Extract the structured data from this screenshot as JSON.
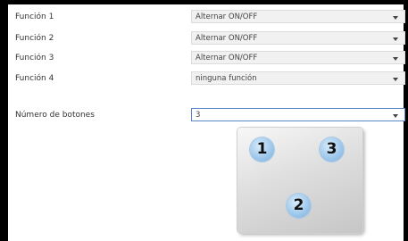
{
  "functions": [
    {
      "label": "Función 1",
      "value": "Alternar ON/OFF"
    },
    {
      "label": "Función 2",
      "value": "Alternar ON/OFF"
    },
    {
      "label": "Función 3",
      "value": "Alternar ON/OFF"
    },
    {
      "label": "Función 4",
      "value": "ninguna función"
    }
  ],
  "buttons": {
    "label": "Número de botones",
    "value": "3"
  },
  "preview": {
    "badges": [
      "1",
      "3",
      "2"
    ]
  },
  "icons": {
    "dropdown": "chevron-down-icon"
  },
  "colors": {
    "active_border": "#5b86c5",
    "badge": "#9cc6ea",
    "field_bg": "#f1f1f1"
  }
}
